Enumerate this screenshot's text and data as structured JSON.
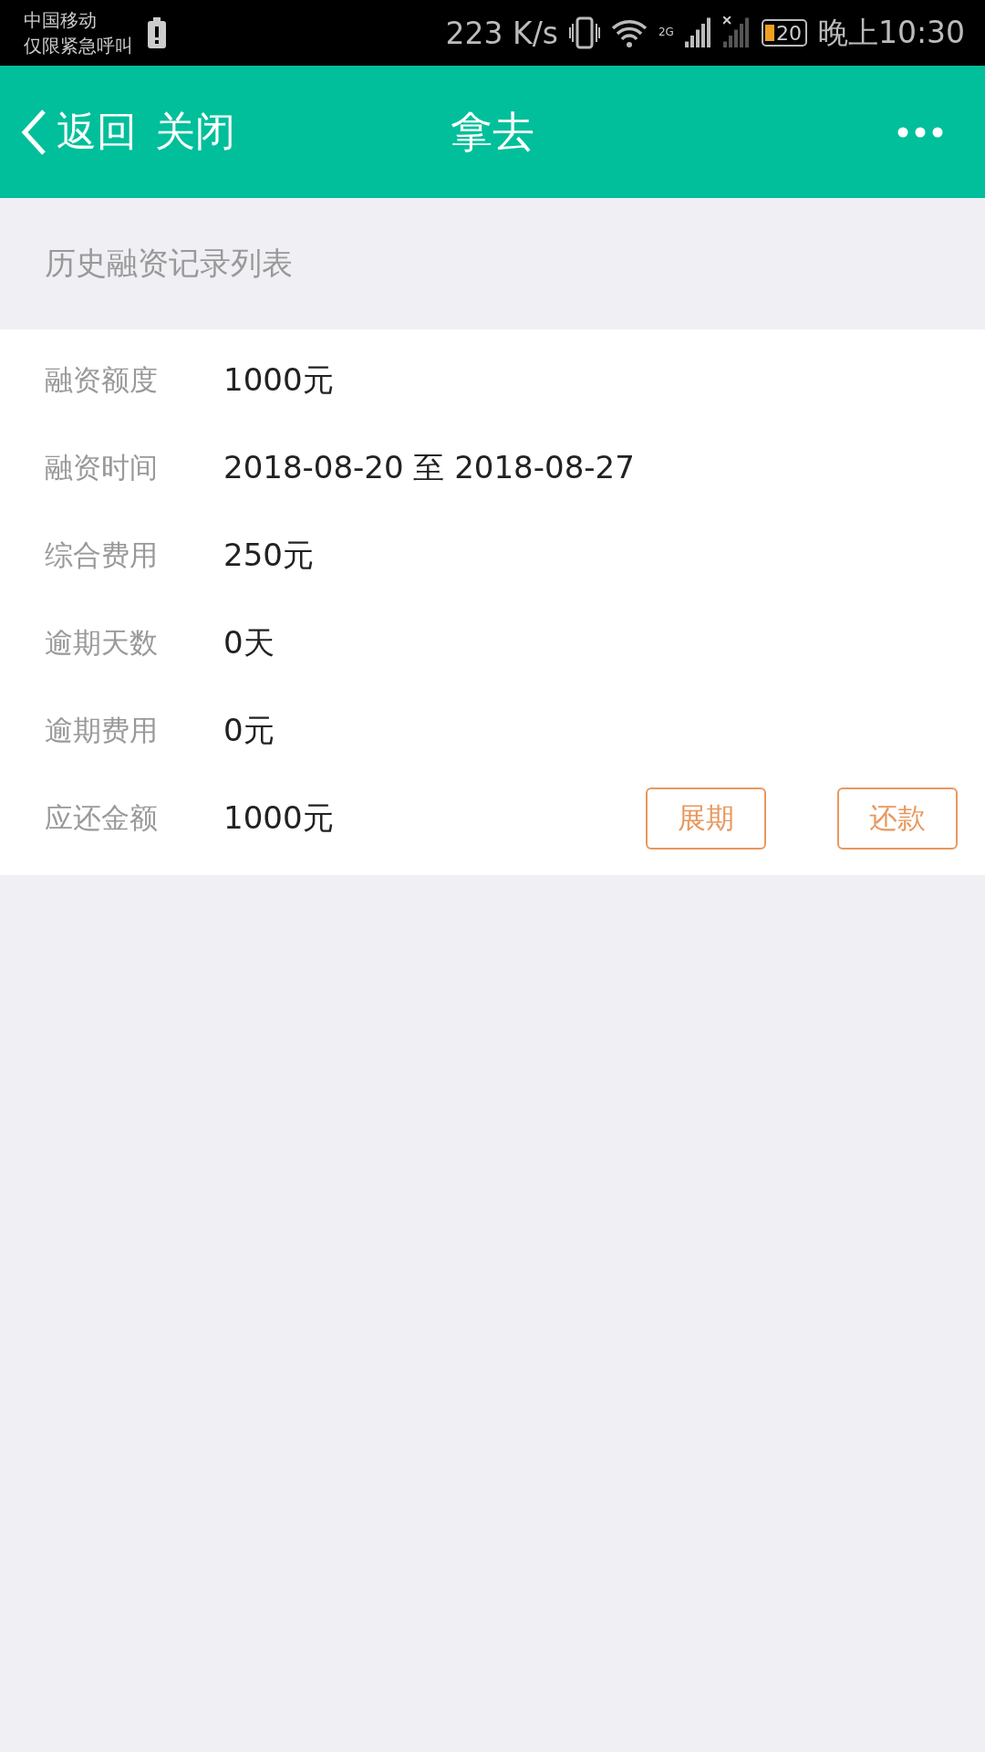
{
  "status_bar": {
    "carrier": "中国移动",
    "carrier_note": "仅限紧急呼叫",
    "speed": "223 K/s",
    "network": "2G",
    "battery": "20",
    "time": "晚上10:30"
  },
  "header": {
    "back": "返回",
    "close": "关闭",
    "title": "拿去"
  },
  "section_title": "历史融资记录列表",
  "record": {
    "fields": [
      {
        "label": "融资额度",
        "value": "1000元"
      },
      {
        "label": "融资时间",
        "value": "2018-08-20 至 2018-08-27"
      },
      {
        "label": "综合费用",
        "value": "250元"
      },
      {
        "label": "逾期天数",
        "value": "0天"
      },
      {
        "label": "逾期费用",
        "value": "0元"
      },
      {
        "label": "应还金额",
        "value": "1000元"
      }
    ],
    "buttons": [
      "展期",
      "还款"
    ]
  }
}
